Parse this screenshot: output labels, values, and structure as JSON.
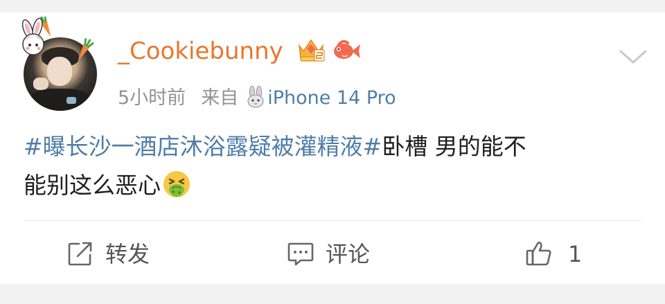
{
  "post": {
    "author": {
      "username": "_Cookiebunny",
      "badges": [
        "crown-vip-badge-icon",
        "fish-badge-icon"
      ]
    },
    "meta": {
      "time_ago": "5小时前",
      "source_label": "来自",
      "source_icon": "rabbit-icon",
      "device": "iPhone 14 Pro"
    },
    "text": {
      "hashtag": "#曝长沙一酒店沐浴露疑被灌精液#",
      "line1_rest": "卧槽 男的能不",
      "line2": "能别这么恶心",
      "trailing_emoji": "vomiting-face-emoji"
    },
    "actions": {
      "repost_label": "转发",
      "comment_label": "评论",
      "like_count": "1"
    }
  },
  "colors": {
    "username": "#e8762d",
    "link": "#4f7da8",
    "meta": "#939393",
    "body_text": "#1f1f1f",
    "background": "#f2f2f2"
  }
}
